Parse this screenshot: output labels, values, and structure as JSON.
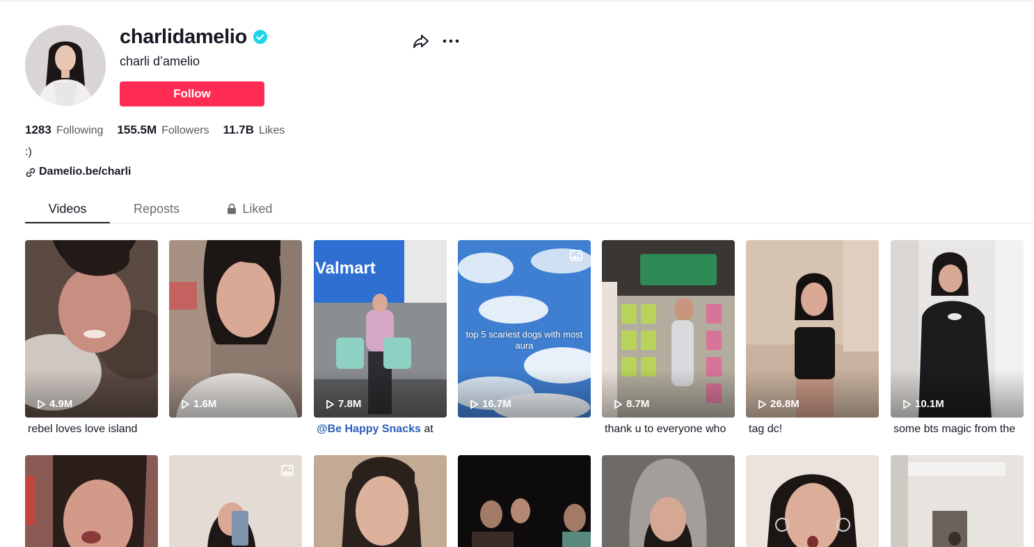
{
  "profile": {
    "username": "charlidamelio",
    "nickname": "charli d’amelio",
    "follow_label": "Follow",
    "bio": ":)",
    "link": "Damelio.be/charli",
    "stats": {
      "following_count": "1283",
      "following_label": "Following",
      "followers_count": "155.5M",
      "followers_label": "Followers",
      "likes_count": "11.7B",
      "likes_label": "Likes"
    }
  },
  "tabs": [
    {
      "label": "Videos",
      "active": true
    },
    {
      "label": "Reposts",
      "active": false
    },
    {
      "label": "Liked",
      "active": false,
      "locked": true
    }
  ],
  "videos": [
    {
      "views": "4.9M",
      "caption": "rebel loves love island",
      "type": "video"
    },
    {
      "views": "1.6M",
      "caption": "",
      "type": "video"
    },
    {
      "views": "7.8M",
      "caption_mention": "@Be Happy Snacks",
      "caption": " at",
      "type": "video"
    },
    {
      "views": "16.7M",
      "caption": "",
      "type": "photo",
      "overlay": "top 5 scariest dogs with most aura"
    },
    {
      "views": "8.7M",
      "caption": "thank u to everyone who",
      "type": "video"
    },
    {
      "views": "26.8M",
      "caption": "tag dc!",
      "type": "video"
    },
    {
      "views": "10.1M",
      "caption": "some bts magic from the",
      "type": "video"
    }
  ],
  "videos_row2": [
    {
      "type": "video"
    },
    {
      "type": "photo"
    },
    {
      "type": "video"
    },
    {
      "type": "video"
    },
    {
      "type": "video"
    },
    {
      "type": "video"
    },
    {
      "type": "video"
    }
  ],
  "colors": {
    "accent": "#fe2c55",
    "verified": "#20d5ec",
    "mention": "#2b5db9",
    "text": "#161823",
    "muted": "#57585e"
  },
  "icons": {
    "verified": "verified-badge-icon",
    "share": "share-arrow-icon",
    "more": "more-dots-icon",
    "link": "link-icon",
    "lock": "lock-icon",
    "play": "play-icon",
    "photo": "photo-icon"
  }
}
